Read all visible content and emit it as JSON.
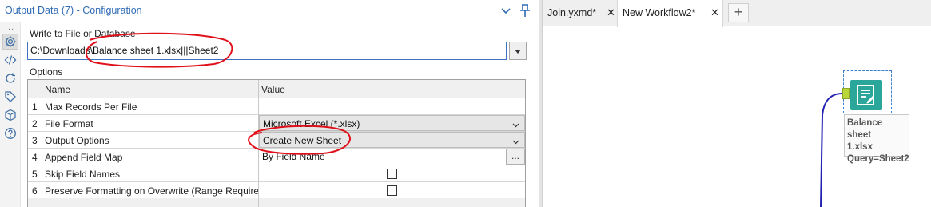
{
  "config": {
    "title": "Output Data (7) - Configuration",
    "side_dots": "...",
    "write_label": "Write to File or Database",
    "path_value": "C:\\Downloads\\Balance sheet 1.xlsx|||Sheet2",
    "options_label": "Options",
    "grid": {
      "col_name": "Name",
      "col_value": "Value",
      "rows": [
        {
          "idx": "1",
          "name": "Max Records Per File",
          "value": ""
        },
        {
          "idx": "2",
          "name": "File Format",
          "value": "Microsoft Excel (*.xlsx)"
        },
        {
          "idx": "3",
          "name": "Output Options",
          "value": "Create New Sheet"
        },
        {
          "idx": "4",
          "name": "Append Field Map",
          "value": "By Field Name",
          "button": "..."
        },
        {
          "idx": "5",
          "name": "Skip Field Names",
          "checked": false
        },
        {
          "idx": "6",
          "name": "Preserve Formatting on Overwrite (Range Required)",
          "checked": false
        }
      ]
    }
  },
  "workflow": {
    "tabs": [
      {
        "label": "Join.yxmd*",
        "close": "✕"
      },
      {
        "label": "New Workflow2*",
        "close": "✕",
        "active": true
      }
    ],
    "add_tab": "+",
    "tool": {
      "label_lines": [
        "Balance sheet",
        "1.xlsx",
        "Query=Sheet2"
      ]
    }
  },
  "colors": {
    "accent": "#2f6bb5",
    "annotation": "#e0101a",
    "tool": "#2aa79a",
    "anchor": "#b9d63a",
    "wire": "#2222b0"
  }
}
